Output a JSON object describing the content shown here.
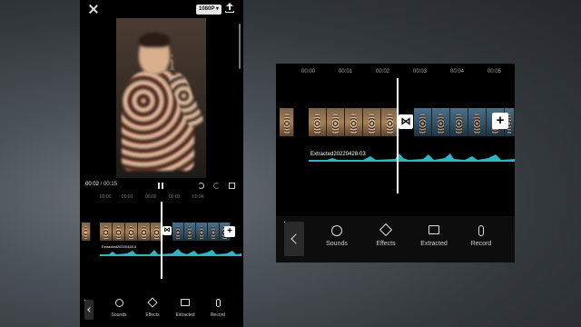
{
  "phone": {
    "resolution": "1080P",
    "time_current": "00:02",
    "time_separator": " / ",
    "time_total": "00:15",
    "ruler_ticks": [
      "00:00",
      "00:01",
      "00:02",
      "00:03",
      "00:04"
    ],
    "audio_label": "Extracted20220428-0",
    "toolbar": [
      {
        "label": "Sounds",
        "icon": "sounds-icon"
      },
      {
        "label": "Effects",
        "icon": "effects-icon"
      },
      {
        "label": "Extracted",
        "icon": "extracted-icon"
      },
      {
        "label": "Record",
        "icon": "record-icon"
      }
    ]
  },
  "panel": {
    "ruler_ticks": [
      "00:00",
      "00:01",
      "00:02",
      "00:03",
      "00:04",
      "00:05"
    ],
    "audio_label": "Extracted20220428-03",
    "toolbar": [
      {
        "label": "Sounds",
        "icon": "sounds-icon"
      },
      {
        "label": "Effects",
        "icon": "effects-icon"
      },
      {
        "label": "Extracted",
        "icon": "extracted-icon"
      },
      {
        "label": "Record",
        "icon": "record-icon"
      }
    ]
  },
  "colors": {
    "app_background": "#000000",
    "waveform": "#2fb5c8",
    "accent_white": "#ffffff"
  }
}
